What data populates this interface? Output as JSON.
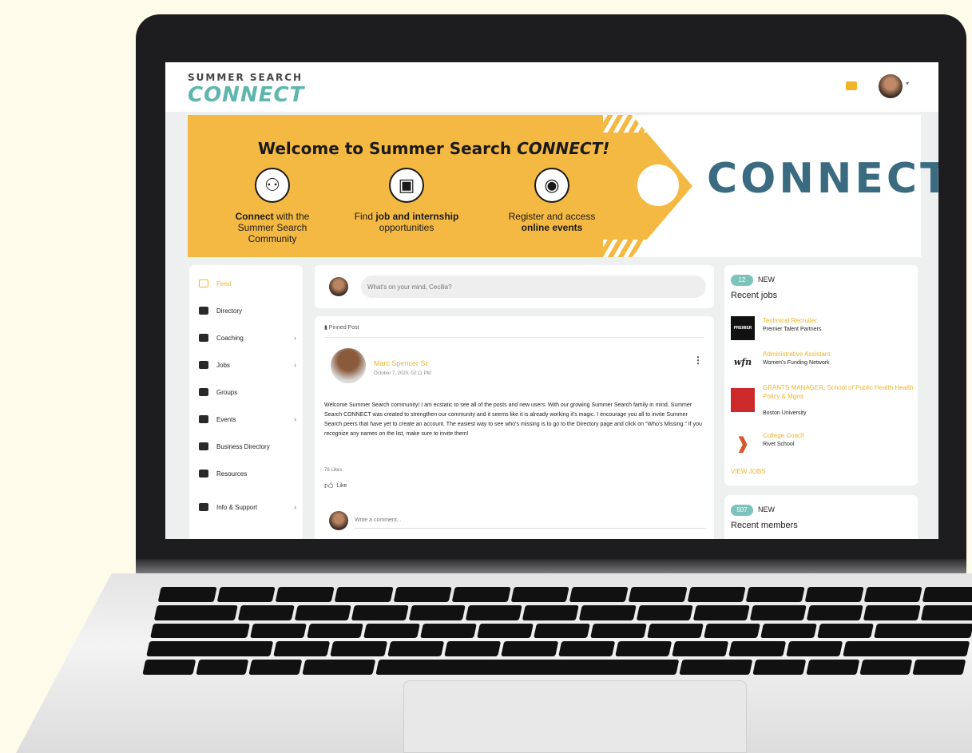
{
  "app": {
    "logo_top": "SUMMER SEARCH",
    "logo_main": "CONNECT"
  },
  "hero": {
    "title": "Welcome to Summer Search",
    "title_emphasis": "CONNECT!",
    "features": [
      {
        "bold": "Connect",
        "text": " with the Summer Search Community",
        "icon": "people-network-icon"
      },
      {
        "pre": "Find ",
        "bold": "job and internship",
        "text": " opportunities",
        "icon": "briefcase-icon"
      },
      {
        "pre": "Register and access ",
        "bold": "online events",
        "text": "",
        "icon": "webcam-icon"
      }
    ],
    "big_word": "CONNECT"
  },
  "nav": {
    "items": [
      {
        "label": "Feed",
        "icon": "calendar-icon",
        "has_caret": false,
        "active": true
      },
      {
        "label": "Directory",
        "icon": "folder-icon",
        "has_caret": false
      },
      {
        "label": "Coaching",
        "icon": "chat-board-icon",
        "has_caret": true
      },
      {
        "label": "Jobs",
        "icon": "briefcase-icon",
        "has_caret": true
      },
      {
        "label": "Groups",
        "icon": "group-icon",
        "has_caret": false
      },
      {
        "label": "Events",
        "icon": "event-icon",
        "has_caret": true
      },
      {
        "label": "Business Directory",
        "icon": "id-card-icon",
        "has_caret": false
      },
      {
        "label": "Resources",
        "icon": "document-icon",
        "has_caret": false
      },
      {
        "label": "Info & Support",
        "icon": "support-icon",
        "has_caret": true
      }
    ]
  },
  "composer": {
    "placeholder": "What's on your mind, Cecilia?"
  },
  "post": {
    "pinned_label": "Pinned Post",
    "author": "Marc Spencer Sr",
    "date": "October 7, 2020, 02:11 PM",
    "body": "Welcome Summer Search community! I am ecstatic to see all of the posts and new users. With our growing Summer Search family in mind, Summer Search CONNECT was created to strengthen our community and it seems like it is already working it's magic. I encourage you all to invite Summer Search peers that have yet to create an account. The easiest way to see who's missing is to go to the Directory page and click on \"Who's Missing.\" If you recognize any names on the list, make sure to invite them!",
    "likes": "76 Likes",
    "like_label": "Like",
    "comment_placeholder": "Write a comment..."
  },
  "jobs_card": {
    "badge": "12",
    "new_label": "NEW",
    "title": "Recent jobs",
    "jobs": [
      {
        "title": "Technical Recruiter",
        "company": "Premier Talent Partners",
        "logo": "PREMIER",
        "logo_bg": "#111111",
        "logo_fg": "#ffffff"
      },
      {
        "title": "Administrative Assistant",
        "company": "Women's Funding Network",
        "logo": "wfn",
        "logo_bg": "#ffffff",
        "logo_fg": "#222222"
      },
      {
        "title": "GRANTS MANAGER, School of Public Health Health Policy & Mgmt",
        "company": "Boston University",
        "logo": "",
        "logo_bg": "#cc2a2a",
        "logo_fg": "#ffffff"
      },
      {
        "title": "College Coach",
        "company": "Rivet School",
        "logo": "❱",
        "logo_bg": "#ffffff",
        "logo_fg": "#d9532b"
      }
    ],
    "view_label": "VIEW JOBS"
  },
  "members_card": {
    "badge": "507",
    "new_label": "NEW",
    "title": "Recent members"
  },
  "colors": {
    "accent": "#f0b429",
    "teal": "#5fb6ad",
    "banner": "#f4b942"
  }
}
